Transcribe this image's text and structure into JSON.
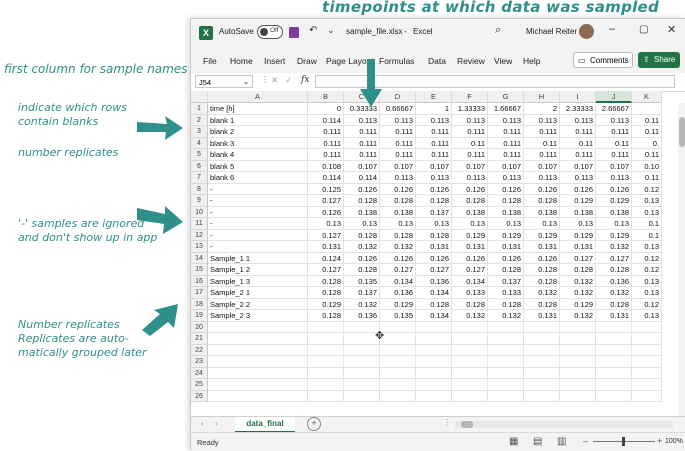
{
  "annotations": {
    "top": "timepoints at which data was sampled",
    "first_col": "first column for sample names",
    "blanks": "indicate which rows\ncontain blanks",
    "replicates": "number replicates",
    "ignored": "'-' samples are ignored\nand don't show up in app",
    "grouped": "Number replicates\nReplicates are auto-\nmatically grouped later"
  },
  "titlebar": {
    "autosave": "AutoSave",
    "toggle": "Off",
    "filename": "sample_file.xlsx",
    "app": "Excel",
    "user": "Michael Reiter"
  },
  "menu": [
    "File",
    "Home",
    "Insert",
    "Draw",
    "Page Layout",
    "Formulas",
    "Data",
    "Review",
    "View",
    "Help"
  ],
  "buttons": {
    "comments": "Comments",
    "share": "Share"
  },
  "formula_bar": {
    "namebox": "J54",
    "fx": "fx"
  },
  "columns": [
    "A",
    "B",
    "C",
    "D",
    "E",
    "F",
    "G",
    "H",
    "I",
    "J",
    "K"
  ],
  "rows": [
    [
      "time [h]",
      "0",
      "0.33333",
      "0.66667",
      "1",
      "1.33333",
      "1.66667",
      "2",
      "2.33333",
      "2.66667",
      ""
    ],
    [
      "blank 1",
      "0.114",
      "0.113",
      "0.113",
      "0.113",
      "0.113",
      "0.113",
      "0.113",
      "0.113",
      "0.113",
      "0.11"
    ],
    [
      "blank 2",
      "0.111",
      "0.111",
      "0.111",
      "0.111",
      "0.111",
      "0.111",
      "0.111",
      "0.111",
      "0.111",
      "0.11"
    ],
    [
      "blank 3",
      "0.111",
      "0.111",
      "0.111",
      "0.111",
      "0.11",
      "0.111",
      "0.11",
      "0.11",
      "0.11",
      "0."
    ],
    [
      "blank 4",
      "0.111",
      "0.111",
      "0.111",
      "0.111",
      "0.111",
      "0.111",
      "0.111",
      "0.111",
      "0.111",
      "0.11"
    ],
    [
      "blank 5",
      "0.108",
      "0.107",
      "0.107",
      "0.107",
      "0.107",
      "0.107",
      "0.107",
      "0.107",
      "0.107",
      "0.10"
    ],
    [
      "blank 6",
      "0.114",
      "0.114",
      "0.113",
      "0.113",
      "0.113",
      "0.113",
      "0.113",
      "0.113",
      "0.113",
      "0.11"
    ],
    [
      "-",
      "0.125",
      "0.126",
      "0.126",
      "0.126",
      "0.126",
      "0.126",
      "0.126",
      "0.126",
      "0.126",
      "0.12"
    ],
    [
      "-",
      "0.127",
      "0.128",
      "0.128",
      "0.128",
      "0.128",
      "0.128",
      "0.128",
      "0.129",
      "0.129",
      "0.13"
    ],
    [
      "-",
      "0.126",
      "0.138",
      "0.138",
      "0.137",
      "0.138",
      "0.138",
      "0.138",
      "0.138",
      "0.138",
      "0.13"
    ],
    [
      "-",
      "0.13",
      "0.13",
      "0.13",
      "0.13",
      "0.13",
      "0.13",
      "0.13",
      "0.13",
      "0.13",
      "0.1"
    ],
    [
      "-",
      "0.127",
      "0.128",
      "0.128",
      "0.128",
      "0.129",
      "0.129",
      "0.129",
      "0.129",
      "0.129",
      "0.1"
    ],
    [
      "-",
      "0.131",
      "0.132",
      "0.132",
      "0.131",
      "0.131",
      "0.131",
      "0.131",
      "0.131",
      "0.132",
      "0.13"
    ],
    [
      "Sample_1 1",
      "0.124",
      "0.126",
      "0.126",
      "0.126",
      "0.126",
      "0.126",
      "0.126",
      "0.127",
      "0.127",
      "0.12"
    ],
    [
      "Sample_1 2",
      "0.127",
      "0.128",
      "0.127",
      "0.127",
      "0.127",
      "0.128",
      "0.128",
      "0.128",
      "0.128",
      "0.12"
    ],
    [
      "Sample_1 3",
      "0.128",
      "0.135",
      "0.134",
      "0.136",
      "0.134",
      "0.137",
      "0.128",
      "0.132",
      "0.136",
      "0.13"
    ],
    [
      "Sample_2 1",
      "0.128",
      "0.137",
      "0.136",
      "0.134",
      "0.133",
      "0.133",
      "0.132",
      "0.132",
      "0.132",
      "0.13"
    ],
    [
      "Sample_2 2",
      "0.129",
      "0.132",
      "0.129",
      "0.128",
      "0.128",
      "0.128",
      "0.128",
      "0.129",
      "0.128",
      "0.12"
    ],
    [
      "Sample_2 3",
      "0.128",
      "0.136",
      "0.135",
      "0.134",
      "0.132",
      "0.132",
      "0.131",
      "0.132",
      "0.131",
      "0.13"
    ],
    [
      "",
      "",
      "",
      "",
      "",
      "",
      "",
      "",
      "",
      "",
      ""
    ],
    [
      "",
      "",
      "",
      "",
      "",
      "",
      "",
      "",
      "",
      "",
      ""
    ],
    [
      "",
      "",
      "",
      "",
      "",
      "",
      "",
      "",
      "",
      "",
      ""
    ],
    [
      "",
      "",
      "",
      "",
      "",
      "",
      "",
      "",
      "",
      "",
      ""
    ],
    [
      "",
      "",
      "",
      "",
      "",
      "",
      "",
      "",
      "",
      "",
      ""
    ],
    [
      "",
      "",
      "",
      "",
      "",
      "",
      "",
      "",
      "",
      "",
      ""
    ],
    [
      "",
      "",
      "",
      "",
      "",
      "",
      "",
      "",
      "",
      "",
      ""
    ]
  ],
  "sheet_tab": "data_final",
  "status": {
    "ready": "Ready",
    "zoom": "100%"
  },
  "colors": {
    "excel_green": "#217346",
    "annot": "#2f8f8a"
  }
}
